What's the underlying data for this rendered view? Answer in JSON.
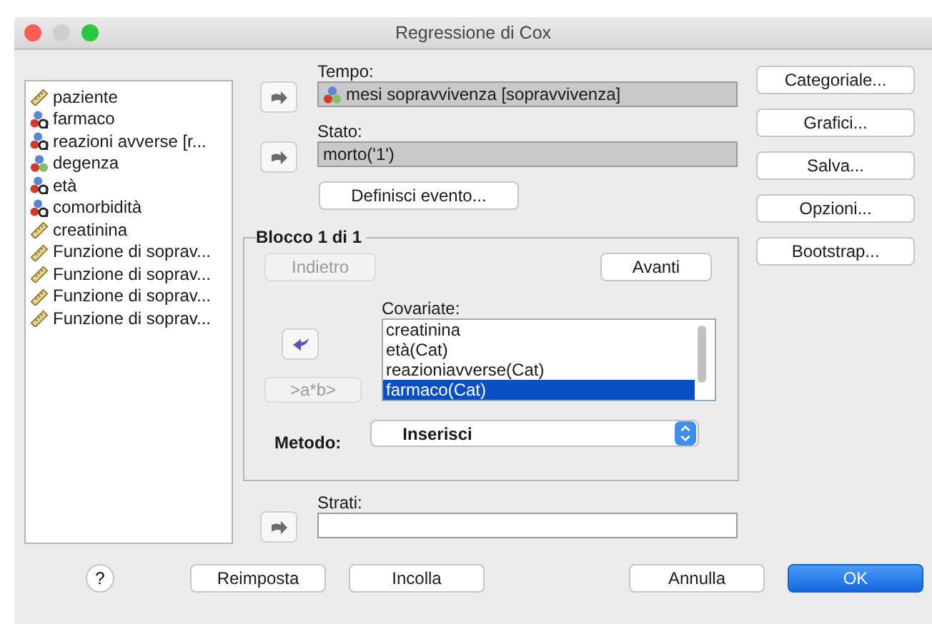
{
  "window": {
    "title": "Regressione di Cox"
  },
  "variables": [
    {
      "name": "paziente",
      "kind": "scale"
    },
    {
      "name": "farmaco",
      "kind": "string"
    },
    {
      "name": "reazioni avverse [r...",
      "kind": "string"
    },
    {
      "name": "degenza",
      "kind": "nominal"
    },
    {
      "name": "età",
      "kind": "string"
    },
    {
      "name": "comorbidità",
      "kind": "string"
    },
    {
      "name": "creatinina",
      "kind": "scale"
    },
    {
      "name": "Funzione di soprav...",
      "kind": "scale"
    },
    {
      "name": "Funzione di soprav...",
      "kind": "scale"
    },
    {
      "name": "Funzione di soprav...",
      "kind": "scale"
    },
    {
      "name": "Funzione di soprav...",
      "kind": "scale"
    }
  ],
  "time": {
    "label": "Tempo:",
    "value": "mesi sopravvivenza [sopravvivenza]",
    "kind": "nominal"
  },
  "status": {
    "label": "Stato:",
    "value": "morto('1')"
  },
  "define_event_button": "Definisci evento...",
  "block": {
    "title": "Blocco 1 di 1",
    "previous": {
      "label": "Indietro",
      "disabled": true
    },
    "next": {
      "label": "Avanti",
      "disabled": false
    },
    "interaction": {
      "label": ">a*b>",
      "disabled": true
    },
    "covariates_label": "Covariate:",
    "covariates": [
      {
        "name": "creatinina",
        "selected": false
      },
      {
        "name": "età(Cat)",
        "selected": false
      },
      {
        "name": "reazioniavverse(Cat)",
        "selected": false
      },
      {
        "name": "farmaco(Cat)",
        "selected": true
      }
    ],
    "method": {
      "label": "Metodo:",
      "value": "Inserisci"
    }
  },
  "strata": {
    "label": "Strati:"
  },
  "side_buttons": [
    "Categoriale...",
    "Grafici...",
    "Salva...",
    "Opzioni...",
    "Bootstrap..."
  ],
  "help_button": "?",
  "buttons": [
    {
      "label": "Reimposta",
      "default": false
    },
    {
      "label": "Incolla",
      "default": false
    },
    {
      "label": "Annulla",
      "default": false
    },
    {
      "label": "OK",
      "default": true
    }
  ]
}
